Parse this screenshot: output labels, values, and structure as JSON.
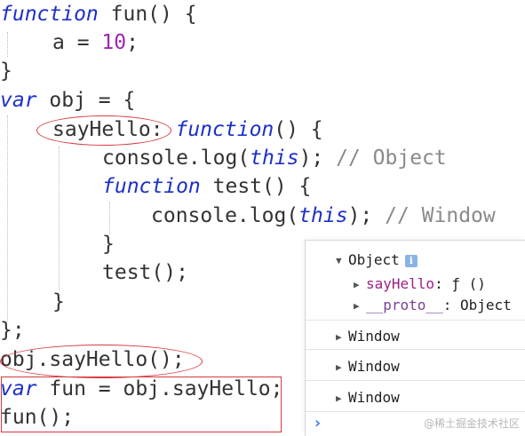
{
  "code": {
    "l1_kw": "function",
    "l1_rest": " fun() {",
    "l2_text": "a = ",
    "l2_num": "10",
    "l2_end": ";",
    "l3": "}",
    "l4_kw": "var",
    "l4_rest": " obj = {",
    "l5_name": "sayHello",
    "l5_colon": ": ",
    "l5_kw": "function",
    "l5_rest": "() {",
    "l6_a": "console.log(",
    "l6_kw": "this",
    "l6_b": "); ",
    "l6_cm": "// Object",
    "l7_kw": "function",
    "l7_rest": " test() {",
    "l8_a": "console.log(",
    "l8_kw": "this",
    "l8_b": "); ",
    "l8_cm": "// Window",
    "l9": "}",
    "l10": "test();",
    "l11": "}",
    "l12": "};",
    "l13": "obj.sayHello();",
    "l14_kw": "var",
    "l14_rest": " fun = obj.sayHello;",
    "l15": "fun();"
  },
  "console": {
    "object_label": "Object",
    "info_icon": "i",
    "prop_name": "sayHello",
    "prop_value": ": ƒ ()",
    "proto_name": "__proto__",
    "proto_value": ": Object",
    "window_1": "Window",
    "window_2": "Window",
    "window_3": "Window",
    "prompt": "›"
  },
  "watermark": "@稀土掘金技术社区",
  "colors": {
    "keyword": "#1c30c8",
    "number": "#9c27b0",
    "comment": "#8a8a8a",
    "annotation": "#d9393e"
  }
}
